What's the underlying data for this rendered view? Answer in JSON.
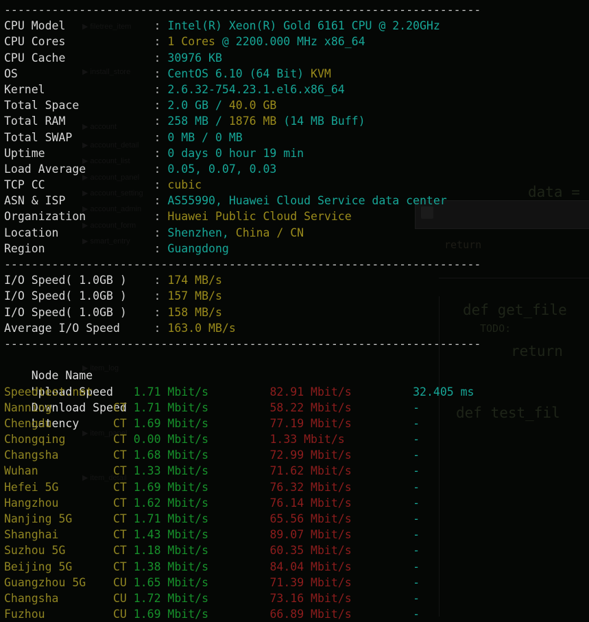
{
  "terminal": {
    "separator": "----------------------------------------------------------------------",
    "system_info": [
      {
        "label": "CPU Model",
        "value_cyan": "Intel(R) Xeon(R) Gold 6161 CPU @ 2.20GHz",
        "value_yellow": "",
        "value_cyan2": ""
      },
      {
        "label": "CPU Cores",
        "value_cyan": "",
        "value_yellow": "1 Cores",
        "value_cyan2": " @ 2200.000 MHz x86_64"
      },
      {
        "label": "CPU Cache",
        "value_cyan": "30976 KB",
        "value_yellow": "",
        "value_cyan2": ""
      },
      {
        "label": "OS",
        "value_cyan": "CentOS 6.10 (64 Bit) ",
        "value_yellow": "KVM",
        "value_cyan2": ""
      },
      {
        "label": "Kernel",
        "value_cyan": "2.6.32-754.23.1.el6.x86_64",
        "value_yellow": "",
        "value_cyan2": ""
      },
      {
        "label": "Total Space",
        "value_cyan": "2.0 GB / ",
        "value_yellow": "40.0 GB",
        "value_cyan2": ""
      },
      {
        "label": "Total RAM",
        "value_cyan": "258 MB / ",
        "value_yellow": "1876 MB",
        "value_cyan2": " (14 MB Buff)"
      },
      {
        "label": "Total SWAP",
        "value_cyan": "0 MB / 0 MB",
        "value_yellow": "",
        "value_cyan2": ""
      },
      {
        "label": "Uptime",
        "value_cyan": "0 days 0 hour 19 min",
        "value_yellow": "",
        "value_cyan2": ""
      },
      {
        "label": "Load Average",
        "value_cyan": "0.05, 0.07, 0.03",
        "value_yellow": "",
        "value_cyan2": ""
      },
      {
        "label": "TCP CC",
        "value_cyan": "",
        "value_yellow": "cubic",
        "value_cyan2": ""
      },
      {
        "label": "ASN & ISP",
        "value_cyan": "AS55990, Huawei Cloud Service data center",
        "value_yellow": "",
        "value_cyan2": ""
      },
      {
        "label": "Organization",
        "value_cyan": "",
        "value_yellow": "Huawei Public Cloud Service",
        "value_cyan2": ""
      },
      {
        "label": "Location",
        "value_cyan": "Shenzhen, ",
        "value_yellow": "China / CN",
        "value_cyan2": ""
      },
      {
        "label": "Region",
        "value_cyan": "Guangdong",
        "value_yellow": "",
        "value_cyan2": ""
      }
    ],
    "io_tests": [
      {
        "label": "I/O Speed( 1.0GB )",
        "value": "174 MB/s"
      },
      {
        "label": "I/O Speed( 1.0GB )",
        "value": "157 MB/s"
      },
      {
        "label": "I/O Speed( 1.0GB )",
        "value": "158 MB/s"
      },
      {
        "label": "Average I/O Speed",
        "value": "163.0 MB/s"
      }
    ],
    "speedtest": {
      "columns": [
        "Node Name",
        "Upload Speed",
        "Download Speed",
        "Latency"
      ],
      "rows": [
        {
          "node": "Speedtest.net",
          "isp": "",
          "upload": "1.71 Mbit/s",
          "download": "82.91 Mbit/s",
          "latency": "32.405 ms"
        },
        {
          "node": "Nanning",
          "isp": "CT",
          "upload": "1.71 Mbit/s",
          "download": "58.22 Mbit/s",
          "latency": "-"
        },
        {
          "node": "Chengdu",
          "isp": "CT",
          "upload": "1.69 Mbit/s",
          "download": "77.19 Mbit/s",
          "latency": "-"
        },
        {
          "node": "Chongqing",
          "isp": "CT",
          "upload": "0.00 Mbit/s",
          "download": "1.33 Mbit/s",
          "latency": "-"
        },
        {
          "node": "Changsha",
          "isp": "CT",
          "upload": "1.68 Mbit/s",
          "download": "72.99 Mbit/s",
          "latency": "-"
        },
        {
          "node": "Wuhan",
          "isp": "CT",
          "upload": "1.33 Mbit/s",
          "download": "71.62 Mbit/s",
          "latency": "-"
        },
        {
          "node": "Hefei 5G",
          "isp": "CT",
          "upload": "1.69 Mbit/s",
          "download": "76.32 Mbit/s",
          "latency": "-"
        },
        {
          "node": "Hangzhou",
          "isp": "CT",
          "upload": "1.62 Mbit/s",
          "download": "76.14 Mbit/s",
          "latency": "-"
        },
        {
          "node": "Nanjing 5G",
          "isp": "CT",
          "upload": "1.71 Mbit/s",
          "download": "65.56 Mbit/s",
          "latency": "-"
        },
        {
          "node": "Shanghai",
          "isp": "CT",
          "upload": "1.43 Mbit/s",
          "download": "89.07 Mbit/s",
          "latency": "-"
        },
        {
          "node": "Suzhou 5G",
          "isp": "CT",
          "upload": "1.18 Mbit/s",
          "download": "60.35 Mbit/s",
          "latency": "-"
        },
        {
          "node": "Beijing 5G",
          "isp": "CT",
          "upload": "1.38 Mbit/s",
          "download": "84.04 Mbit/s",
          "latency": "-"
        },
        {
          "node": "Guangzhou 5G",
          "isp": "CU",
          "upload": "1.65 Mbit/s",
          "download": "71.39 Mbit/s",
          "latency": "-"
        },
        {
          "node": "Changsha",
          "isp": "CU",
          "upload": "1.72 Mbit/s",
          "download": "73.16 Mbit/s",
          "latency": "-"
        },
        {
          "node": "Fuzhou",
          "isp": "CU",
          "upload": "1.69 Mbit/s",
          "download": "66.89 Mbit/s",
          "latency": "-"
        }
      ]
    }
  },
  "background": {
    "code_fragments": [
      "def get_file",
      "TODO:",
      "return",
      "def test_fil",
      "data ="
    ]
  },
  "colors": {
    "background": "#050705",
    "label": "#d6d6d6",
    "cyan": "#17a697",
    "yellow": "#9a8b1c",
    "green": "#17912b",
    "red": "#8e1d1d",
    "separator": "#c7c7c7"
  }
}
